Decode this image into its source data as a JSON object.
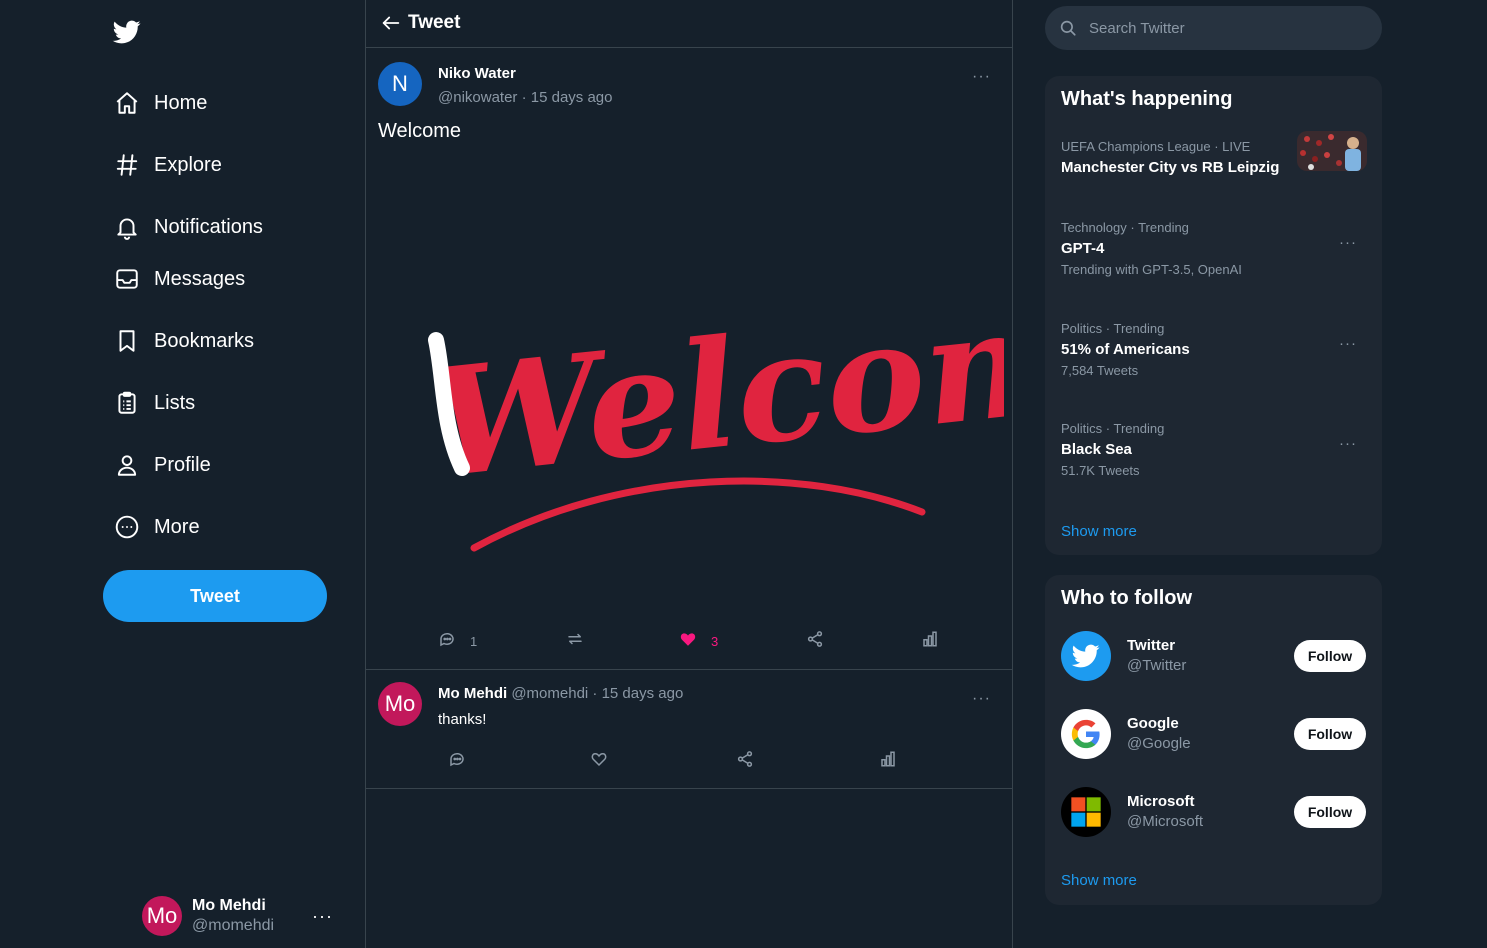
{
  "sidebar": {
    "logo_icon": "twitter-bird-icon",
    "items": [
      {
        "label": "Home",
        "icon": "home-icon"
      },
      {
        "label": "Explore",
        "icon": "hashtag-icon"
      },
      {
        "label": "Notifications",
        "icon": "bell-icon"
      },
      {
        "label": "Messages",
        "icon": "inbox-icon"
      },
      {
        "label": "Bookmarks",
        "icon": "bookmark-icon"
      },
      {
        "label": "Lists",
        "icon": "clipboard-icon"
      },
      {
        "label": "Profile",
        "icon": "person-icon"
      },
      {
        "label": "More",
        "icon": "more-circle-icon"
      }
    ],
    "tweet_button": "Tweet",
    "account": {
      "avatar_text": "Mo",
      "name": "Mo Mehdi",
      "handle": "@momehdi",
      "more": "···"
    }
  },
  "header": {
    "title": "Tweet"
  },
  "post": {
    "avatar_text": "N",
    "author": "Niko Water",
    "meta": "@nikowater · 15 days ago",
    "more": "···",
    "text": "Welcome",
    "media_text": "Welcome",
    "reply_count": "1",
    "like_count": "3"
  },
  "reply": {
    "avatar_text": "Mo",
    "author": "Mo Mehdi",
    "meta": "@momehdi · 15 days ago",
    "text": "thanks!",
    "more": "···"
  },
  "search": {
    "placeholder": "Search Twitter"
  },
  "trends": {
    "title": "What's happening",
    "items": [
      {
        "category": "UEFA Champions League · LIVE",
        "title": "Manchester City vs RB Leipzig",
        "subtitle": ""
      },
      {
        "category": "Technology · Trending",
        "title": "GPT-4",
        "subtitle": "Trending with GPT-3.5, OpenAI"
      },
      {
        "category": "Politics · Trending",
        "title": "51% of Americans",
        "subtitle": "7,584 Tweets"
      },
      {
        "category": "Politics · Trending",
        "title": "Black Sea",
        "subtitle": "51.7K Tweets"
      }
    ],
    "show_more": "Show more",
    "more": "···"
  },
  "who_to_follow": {
    "title": "Who to follow",
    "items": [
      {
        "name": "Twitter",
        "handle": "@Twitter",
        "button": "Follow"
      },
      {
        "name": "Google",
        "handle": "@Google",
        "button": "Follow"
      },
      {
        "name": "Microsoft",
        "handle": "@Microsoft",
        "button": "Follow"
      }
    ],
    "show_more": "Show more"
  },
  "colors": {
    "background": "#15202b",
    "panel": "#1e2732",
    "accent": "#1d9bf0",
    "muted": "#8b98a5",
    "like": "#f91880",
    "welcome_red": "#e0243f"
  }
}
